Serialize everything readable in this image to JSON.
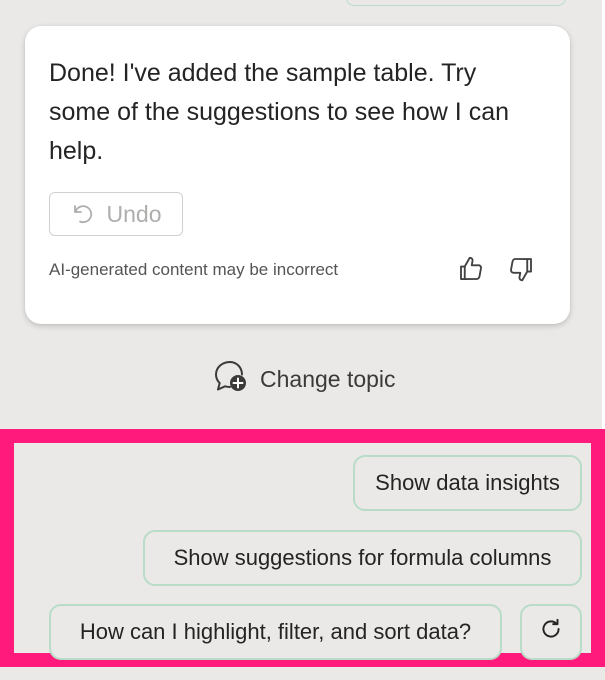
{
  "chat": {
    "message": "Done! I've added the sample table. Try some of the suggestions to see how I can help.",
    "undo_label": "Undo",
    "disclaimer": "AI-generated content may be incorrect",
    "change_topic_label": "Change topic"
  },
  "suggestions": {
    "items": [
      "Show data insights",
      "Show suggestions for formula columns",
      "How can I highlight, filter, and sort data?"
    ]
  },
  "icons": {
    "undo": "undo-icon",
    "thumbs_up": "thumbs-up-icon",
    "thumbs_down": "thumbs-down-icon",
    "change_topic": "chat-bubble-add-icon",
    "refresh": "refresh-icon"
  },
  "colors": {
    "background": "#ebe9e7",
    "card": "#ffffff",
    "chip_border": "#b8dcc7",
    "highlight_border": "#ff1a7b"
  }
}
